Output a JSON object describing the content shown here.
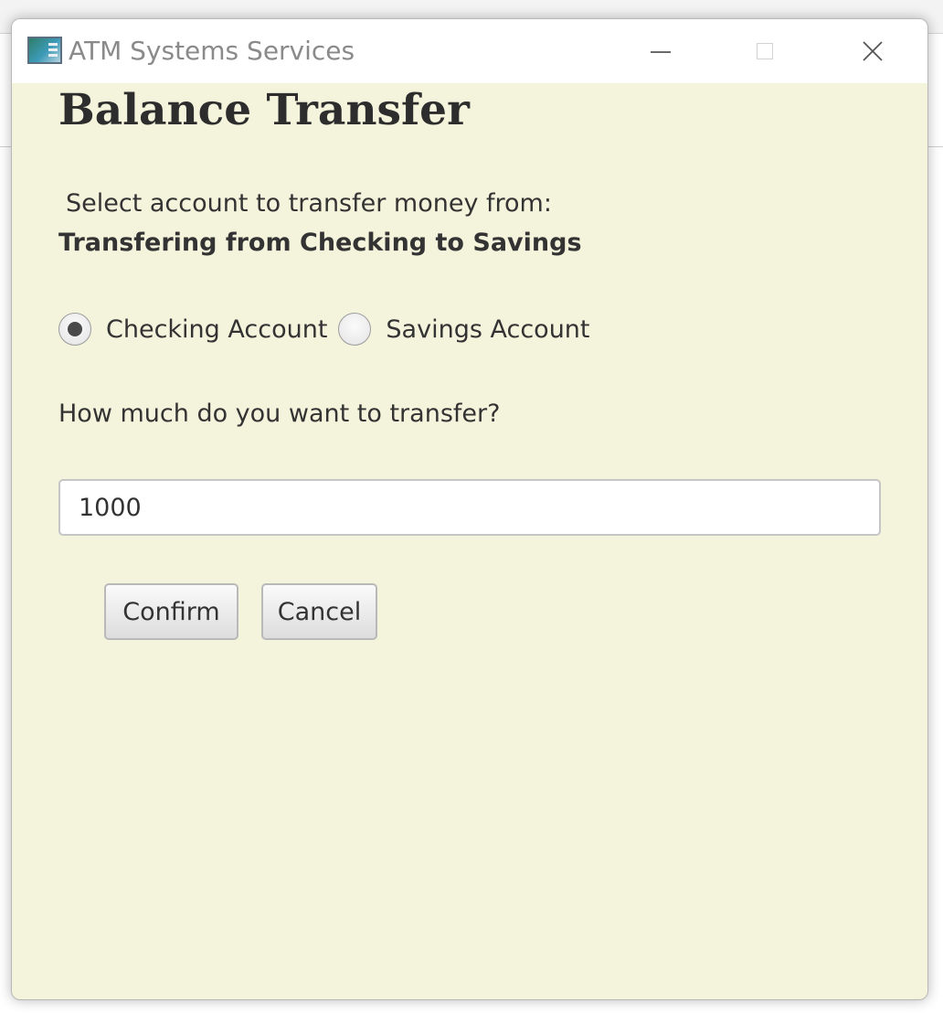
{
  "window": {
    "title": "ATM Systems Services",
    "icon": "app-icon"
  },
  "window_controls": {
    "minimize_icon": "minimize-icon",
    "maximize_icon": "maximize-icon",
    "close_icon": "close-icon"
  },
  "dialog": {
    "heading": "Balance Transfer",
    "select_prompt": "Select account to transfer money from:",
    "transfer_status": "Transfering from Checking to Savings",
    "accounts": [
      {
        "label": "Checking Account",
        "selected": true
      },
      {
        "label": "Savings Account",
        "selected": false
      }
    ],
    "amount_prompt": "How much do you want to transfer?",
    "amount_value": "1000",
    "confirm_label": "Confirm",
    "cancel_label": "Cancel"
  },
  "colors": {
    "dialog_background": "#f4f3dc",
    "titlebar_background": "#ffffff",
    "text": "#333333"
  }
}
